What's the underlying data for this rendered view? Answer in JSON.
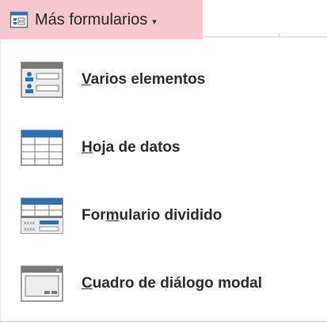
{
  "ribbon_button": {
    "label": "Más formularios",
    "caret": "▾",
    "icon": "form-icon",
    "highlight_color": "#f4c6cd"
  },
  "menu": {
    "items": [
      {
        "pre": "",
        "accel": "V",
        "post": "arios elementos",
        "icon": "multiple-items-icon"
      },
      {
        "pre": "",
        "accel": "H",
        "post": "oja de datos",
        "icon": "datasheet-icon"
      },
      {
        "pre": "For",
        "accel": "m",
        "post": "ulario dividido",
        "icon": "split-form-icon"
      },
      {
        "pre": "",
        "accel": "C",
        "post": "uadro de diálogo modal",
        "icon": "modal-dialog-icon"
      }
    ]
  },
  "colors": {
    "icon_blue": "#2e6fb5",
    "icon_gray": "#7a7a7a",
    "icon_light": "#ececec"
  }
}
